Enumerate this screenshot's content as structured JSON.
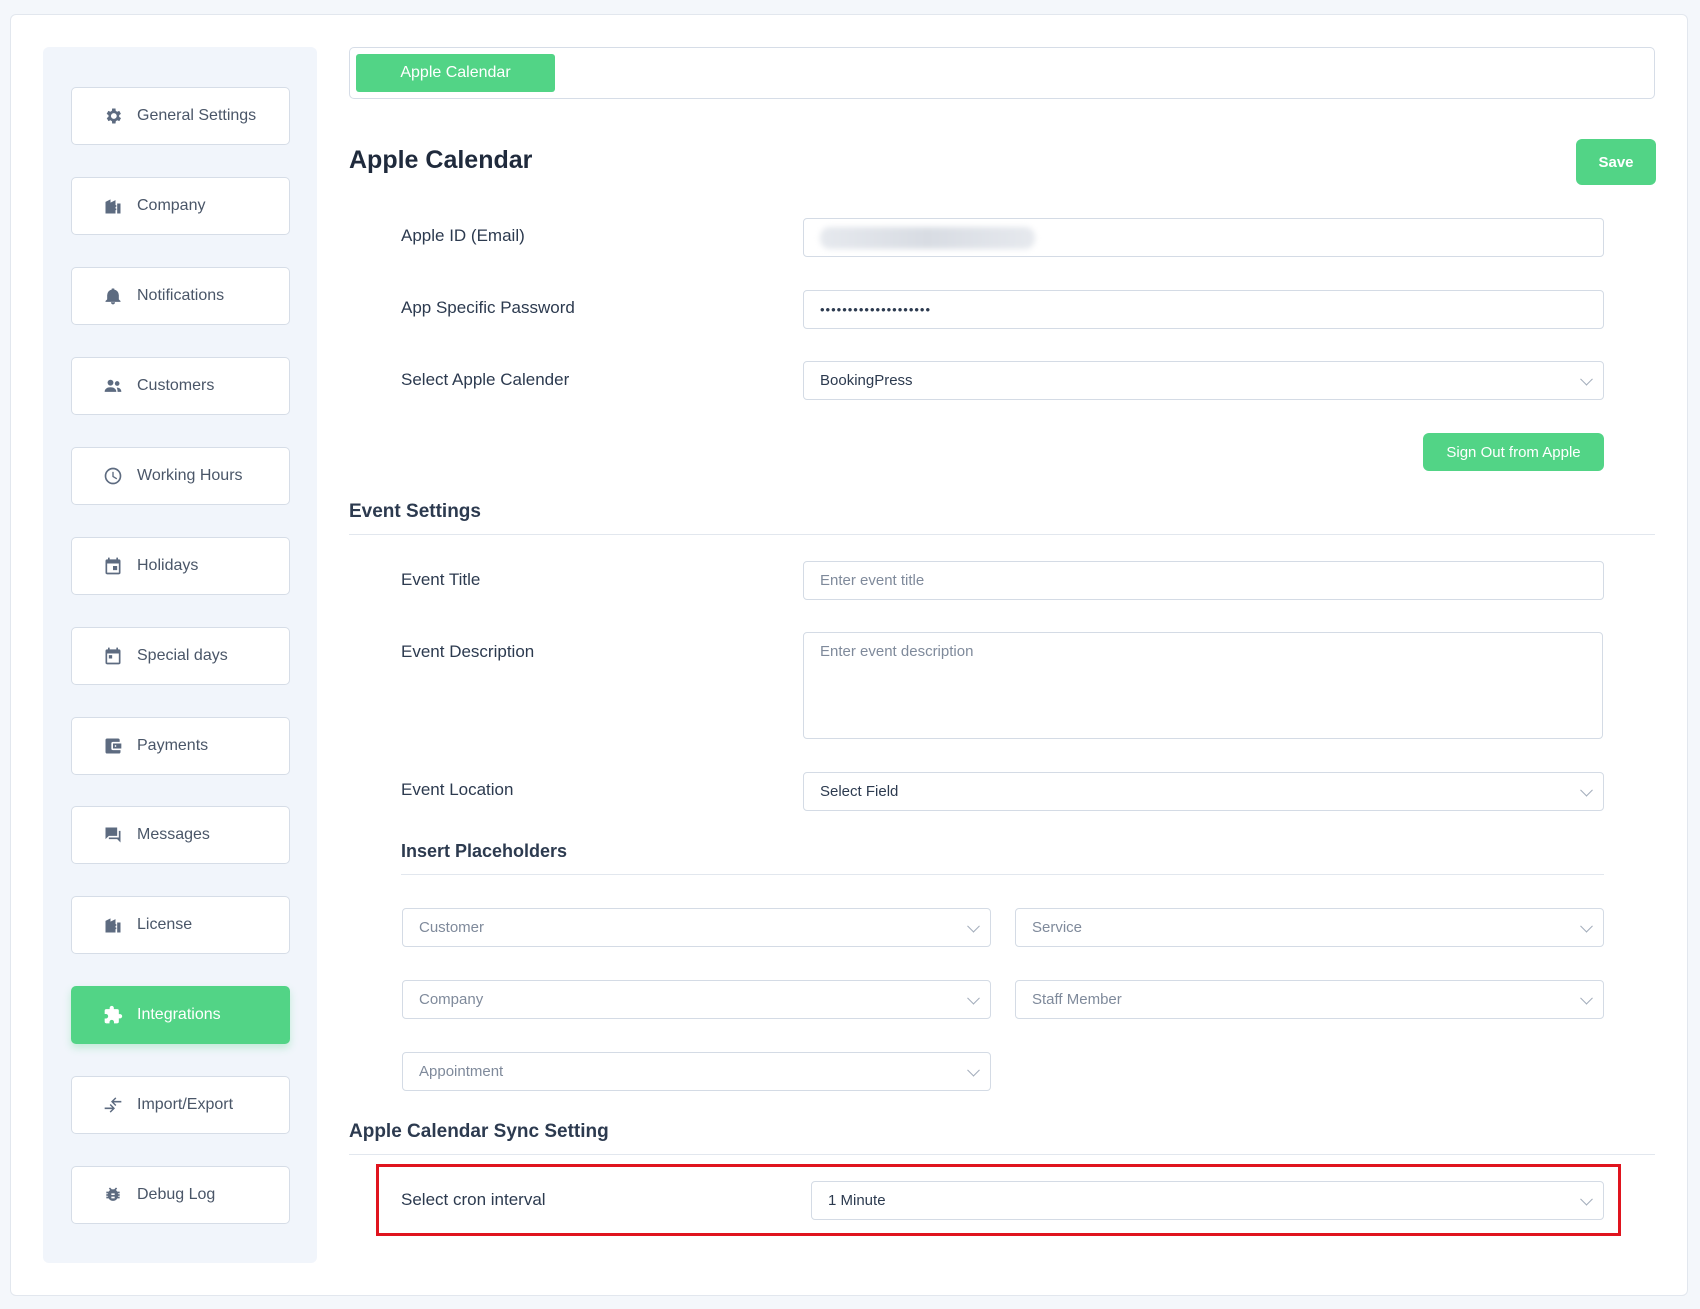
{
  "sidebar": {
    "items": [
      {
        "label": "General Settings",
        "icon": "gear-icon"
      },
      {
        "label": "Company",
        "icon": "building-icon"
      },
      {
        "label": "Notifications",
        "icon": "bell-icon"
      },
      {
        "label": "Customers",
        "icon": "users-icon"
      },
      {
        "label": "Working Hours",
        "icon": "clock-icon"
      },
      {
        "label": "Holidays",
        "icon": "calendar-icon"
      },
      {
        "label": "Special days",
        "icon": "calendar-event-icon"
      },
      {
        "label": "Payments",
        "icon": "wallet-icon"
      },
      {
        "label": "Messages",
        "icon": "chat-icon"
      },
      {
        "label": "License",
        "icon": "building-icon"
      },
      {
        "label": "Integrations",
        "icon": "puzzle-icon",
        "active": true
      },
      {
        "label": "Import/Export",
        "icon": "import-export-icon"
      },
      {
        "label": "Debug Log",
        "icon": "bug-icon"
      }
    ]
  },
  "tabs": {
    "active": "Apple Calendar"
  },
  "page": {
    "title": "Apple Calendar",
    "save_label": "Save"
  },
  "account": {
    "apple_id_label": "Apple ID (Email)",
    "password_label": "App Specific Password",
    "password_value": "••••••••••••••••••••",
    "calendar_label": "Select Apple Calender",
    "calendar_value": "BookingPress",
    "sign_out_label": "Sign Out from Apple"
  },
  "event_settings": {
    "heading": "Event Settings",
    "title_label": "Event Title",
    "title_placeholder": "Enter event title",
    "description_label": "Event Description",
    "description_placeholder": "Enter event description",
    "location_label": "Event Location",
    "location_value": "Select Field",
    "placeholders_heading": "Insert Placeholders",
    "placeholder_selects": [
      "Customer",
      "Service",
      "Company",
      "Staff Member",
      "Appointment"
    ]
  },
  "sync": {
    "heading": "Apple Calendar Sync Setting",
    "cron_label": "Select cron interval",
    "cron_value": "1 Minute"
  },
  "colors": {
    "accent": "#52d486",
    "highlight": "#e0141e"
  }
}
